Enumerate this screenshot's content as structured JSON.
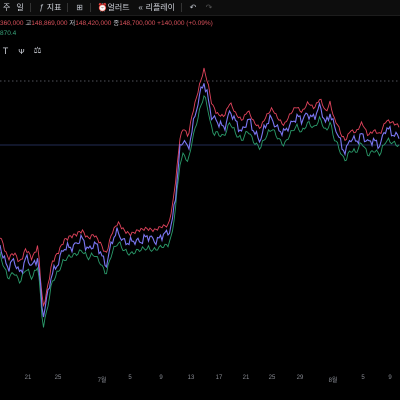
{
  "toolbar": {
    "interval_label": "주",
    "day_label": "일",
    "indicators_label": "지표",
    "alert_label": "얼러트",
    "replay_label": "리플레이"
  },
  "legend": {
    "open_value": "360,000",
    "high_label": "고",
    "high_value": "148,869,000",
    "low_label": "저",
    "low_value": "148,420,000",
    "close_label": "종",
    "close_value": "148,700,000",
    "change": "+140,000 (+0.09%)",
    "indicator_value": "870.4"
  },
  "xaxis_ticks": [
    "",
    "21",
    "25",
    "7월",
    "5",
    "9",
    "13",
    "17",
    "21",
    "25",
    "29",
    "8월",
    "5",
    "9"
  ],
  "colors": {
    "background": "#000000",
    "price_line": "#7b77f2",
    "upper_band": "#e0435c",
    "lower_band": "#2a9a6a",
    "dotted_level": "#6a6e78",
    "price_level": "#2e3a70"
  },
  "icons": [
    "chevron-down-icon",
    "indicators-icon",
    "grid-icon",
    "alert-icon",
    "replay-icon",
    "undo-icon",
    "redo-icon",
    "text-tool-icon",
    "fork-tool-icon",
    "balance-tool-icon"
  ]
}
